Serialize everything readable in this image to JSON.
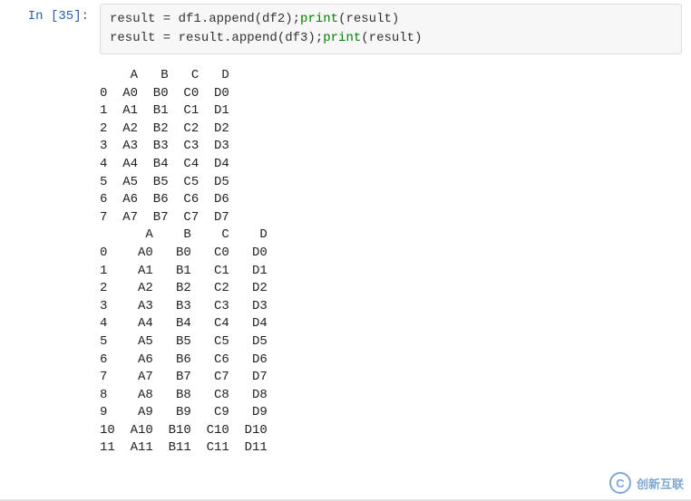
{
  "prompt": "In [35]:",
  "code": {
    "line1_plain": "result = df1.append(df2);",
    "line1_print": "print",
    "line1_tail": "(result)",
    "line2_plain": "result = result.append(df3);",
    "line2_print": "print",
    "line2_tail": "(result)"
  },
  "output1": {
    "header": "    A   B   C   D",
    "rows": [
      "0  A0  B0  C0  D0",
      "1  A1  B1  C1  D1",
      "2  A2  B2  C2  D2",
      "3  A3  B3  C3  D3",
      "4  A4  B4  C4  D4",
      "5  A5  B5  C5  D5",
      "6  A6  B6  C6  D6",
      "7  A7  B7  C7  D7"
    ]
  },
  "output2": {
    "header": "      A    B    C    D",
    "rows": [
      "0    A0   B0   C0   D0",
      "1    A1   B1   C1   D1",
      "2    A2   B2   C2   D2",
      "3    A3   B3   C3   D3",
      "4    A4   B4   C4   D4",
      "5    A5   B5   C5   D5",
      "6    A6   B6   C6   D6",
      "7    A7   B7   C7   D7",
      "8    A8   B8   C8   D8",
      "9    A9   B9   C9   D9",
      "10  A10  B10  C10  D10",
      "11  A11  B11  C11  D11"
    ]
  },
  "watermark": {
    "logo_text": "C",
    "brand": "创新互联"
  }
}
